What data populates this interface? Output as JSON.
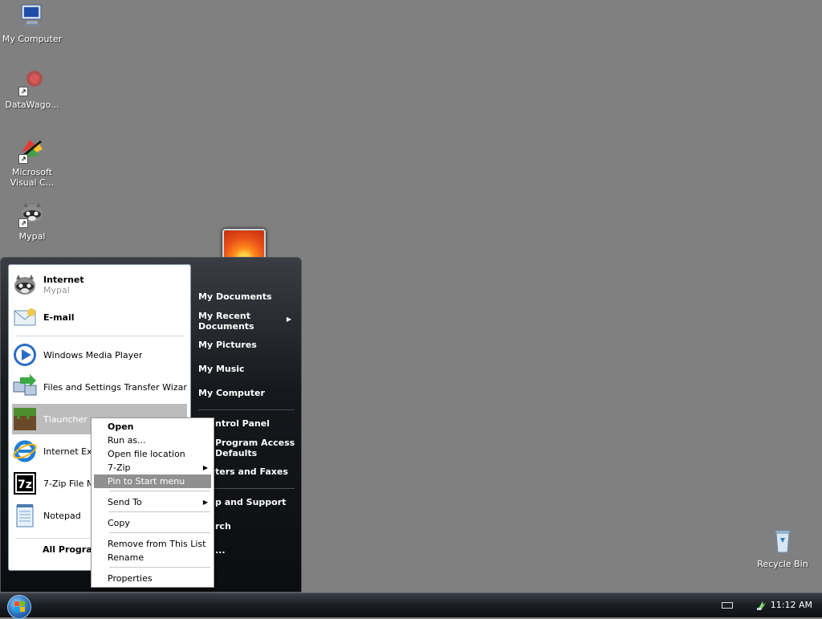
{
  "desktop": {
    "icons": [
      {
        "label": "My Computer",
        "icon": "computer-icon"
      },
      {
        "label": "DataWago...",
        "icon": "datawago-icon"
      },
      {
        "label": "Microsoft Visual C...",
        "icon": "visual-studio-icon"
      },
      {
        "label": "Mypal",
        "icon": "mypal-icon"
      },
      {
        "label": "Recycle Bin",
        "icon": "recycle-bin-icon"
      }
    ]
  },
  "start_menu": {
    "pinned": [
      {
        "title": "Internet",
        "subtitle": "Mypal",
        "icon": "mypal-icon"
      },
      {
        "title": "E-mail",
        "icon": "email-icon"
      }
    ],
    "recent": [
      {
        "label": "Windows Media Player",
        "icon": "media-player-icon"
      },
      {
        "label": "Files and Settings Transfer Wizard",
        "icon": "transfer-wizard-icon"
      },
      {
        "label": "Tlauncher",
        "icon": "tlauncher-icon"
      },
      {
        "label": "Internet Exp",
        "icon": "internet-explorer-icon"
      },
      {
        "label": "7-Zip File M",
        "icon": "7zip-icon"
      },
      {
        "label": "Notepad",
        "icon": "notepad-icon"
      }
    ],
    "all_programs": "All Program",
    "right": {
      "my_documents": "My Documents",
      "my_recent_documents_1": "My Recent",
      "my_recent_documents_2": "Documents",
      "my_pictures": "My Pictures",
      "my_music": "My Music",
      "my_computer": "My Computer",
      "control_panel": "ntrol Panel",
      "program_access_1": "Program Access",
      "program_access_2": "Defaults",
      "printers": "ters and Faxes",
      "help": "p and Support",
      "search": "rch",
      "run": "..."
    }
  },
  "context_menu": {
    "open": "Open",
    "run_as": "Run as...",
    "open_file_location": "Open file location",
    "seven_zip": "7-Zip",
    "pin_to_start": "Pin to Start menu",
    "send_to": "Send To",
    "copy": "Copy",
    "remove_from_list": "Remove from This List",
    "rename": "Rename",
    "properties": "Properties"
  },
  "taskbar": {
    "clock": "11:12 AM"
  },
  "colors": {
    "desktop": "#808080",
    "highlight": "#909090"
  }
}
